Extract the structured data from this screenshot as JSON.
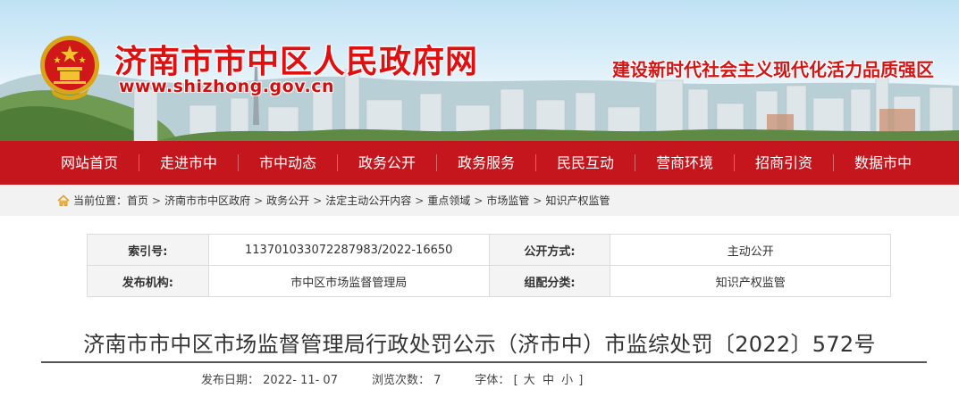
{
  "header": {
    "site_title": "济南市市中区人民政府网",
    "site_url": "www.shizhong.gov.cn",
    "slogan": "建设新时代社会主义现代化活力品质强区"
  },
  "nav": {
    "items": [
      "网站首页",
      "走进市中",
      "市中动态",
      "政务公开",
      "政务服务",
      "民民互动",
      "营商环境",
      "招商引资",
      "数据市中"
    ]
  },
  "breadcrumb": {
    "label": "当前位置：",
    "items": [
      "首页",
      "济南市市中区政府",
      "政务公开",
      "法定主动公开内容",
      "重点领域",
      "市场监管",
      "知识产权监管"
    ],
    "separator": ">"
  },
  "info": {
    "index_label": "索引号:",
    "index_value": "113701033072287983/2022-16650",
    "method_label": "公开方式:",
    "method_value": "主动公开",
    "publisher_label": "发布机构:",
    "publisher_value": "市中区市场监督管理局",
    "category_label": "组配分类:",
    "category_value": "知识产权监管"
  },
  "article": {
    "title": "济南市市中区市场监督管理局行政处罚公示（济市中）市监综处罚〔2022〕572号",
    "date_label": "发布日期：",
    "date_value": "2022- 11- 07",
    "views_label": "浏览次数：",
    "views_value": "7",
    "font_label": "字体：",
    "font_open": "[",
    "font_large": "大",
    "font_medium": "中",
    "font_small": "小",
    "font_close": "]"
  },
  "colors": {
    "nav_red": "#c4161c",
    "title_red": "#e01010"
  },
  "icons": {
    "emblem": "national-emblem",
    "breadcrumb": "home-icon"
  }
}
